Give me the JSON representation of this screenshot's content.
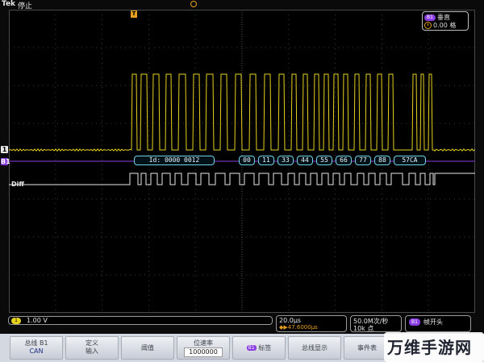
{
  "header": {
    "brand": "Tek",
    "run_status": "停止",
    "trigger_marker": "T"
  },
  "channels": {
    "ch1_tag": "1",
    "bus_tag": "B1",
    "diff_label": "Diff"
  },
  "readout": {
    "badge": "B1",
    "row1": "垂直",
    "row2": "0.00 格"
  },
  "bus_decode": {
    "id_label": "Id: 0000 0012",
    "data_bytes": [
      "00",
      "11",
      "33",
      "44",
      "55",
      "66",
      "77",
      "88"
    ],
    "crc_label": "57CA"
  },
  "status": {
    "ch1_chip": "1",
    "ch1_scale": "1.00 V",
    "time_scale": "20.0μs",
    "time_offset": "◆▶47.6000μs",
    "sample_rate": "50.0M次/秒",
    "record_length": "10k 点",
    "trigger_chip": "B1",
    "trigger_label": "帧开头"
  },
  "menu": {
    "bus": {
      "line1": "总线 B1",
      "line2": "CAN"
    },
    "define": {
      "line1": "定义",
      "line2": "输入"
    },
    "threshold": "阈值",
    "bitrate": {
      "line1": "位速率",
      "line2": "1000000"
    },
    "label": {
      "badge": "B1",
      "text": "标签"
    },
    "bus_display": "总线显示",
    "event_table": "事件表"
  },
  "watermark": "万维手游网",
  "colors": {
    "ch1_yellow": "#e6d21e",
    "bus_purple": "#8a3ce0",
    "decode_cyan": "#6fd3e8",
    "trigger_orange": "#e6a01e"
  }
}
